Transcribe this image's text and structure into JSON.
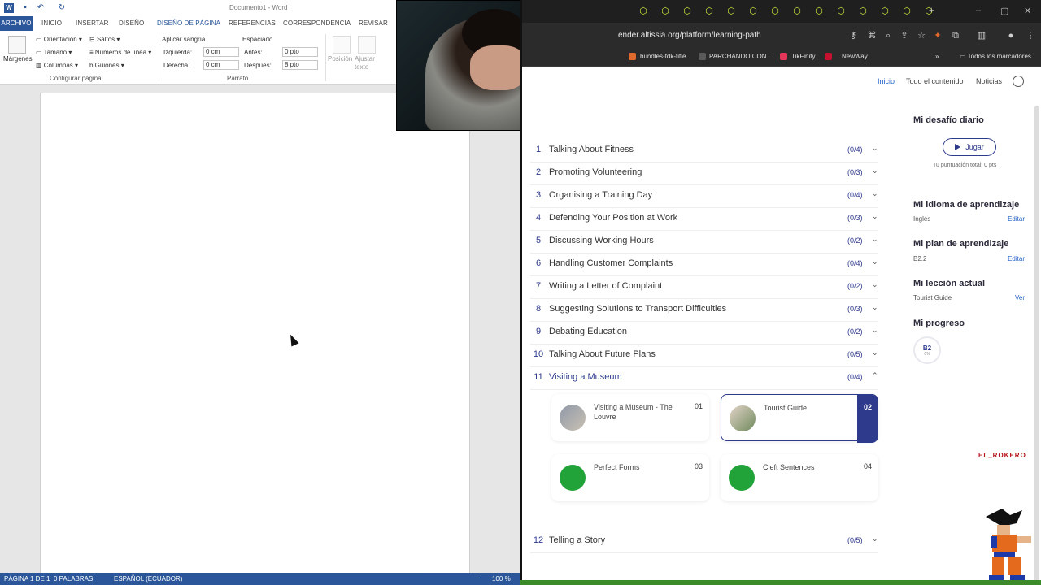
{
  "word": {
    "title": "Documento1 - Word",
    "tabs": [
      "ARCHIVO",
      "INICIO",
      "INSERTAR",
      "DISEÑO",
      "DISEÑO DE PÁGINA",
      "REFERENCIAS",
      "CORRESPONDENCIA",
      "REVISAR"
    ],
    "active_tab": "DISEÑO DE PÁGINA",
    "ribbon": {
      "margins": "Márgenes",
      "orientation": "Orientación",
      "size": "Tamaño",
      "columns": "Columnas",
      "breaks": "Saltos",
      "line_numbers": "Números de línea",
      "hyphenation": "Guiones",
      "group_page_setup": "Configurar página",
      "indent_label": "Aplicar sangría",
      "indent_left_label": "Izquierda:",
      "indent_left_value": "0 cm",
      "indent_right_label": "Derecha:",
      "indent_right_value": "0 cm",
      "spacing_label": "Espaciado",
      "spacing_before_label": "Antes:",
      "spacing_before_value": "0 pto",
      "spacing_after_label": "Después:",
      "spacing_after_value": "8 pto",
      "group_paragraph": "Párrafo",
      "position": "Posición",
      "wrap_text": "Ajustar texto"
    },
    "status": {
      "page": "PÁGINA 1 DE 1",
      "words": "0 PALABRAS",
      "language": "ESPAÑOL (ECUADOR)",
      "zoom": "100 %"
    }
  },
  "browser": {
    "url": "ender.altissia.org/platform/learning-path",
    "bookmarks": [
      "bundles-tdk-title",
      "PARCHANDO CON...",
      "TikFinity",
      "NewWay",
      "Todos los marcadores"
    ]
  },
  "site": {
    "nav": [
      "Inicio",
      "Todo el contenido",
      "Noticias"
    ],
    "lessons": [
      {
        "num": "1",
        "title": "Talking About Fitness",
        "count": "(0/4)"
      },
      {
        "num": "2",
        "title": "Promoting Volunteering",
        "count": "(0/3)"
      },
      {
        "num": "3",
        "title": "Organising a Training Day",
        "count": "(0/4)"
      },
      {
        "num": "4",
        "title": "Defending Your Position at Work",
        "count": "(0/3)"
      },
      {
        "num": "5",
        "title": "Discussing Working Hours",
        "count": "(0/2)"
      },
      {
        "num": "6",
        "title": "Handling Customer Complaints",
        "count": "(0/4)"
      },
      {
        "num": "7",
        "title": "Writing a Letter of Complaint",
        "count": "(0/2)"
      },
      {
        "num": "8",
        "title": "Suggesting Solutions to Transport Difficulties",
        "count": "(0/3)"
      },
      {
        "num": "9",
        "title": "Debating Education",
        "count": "(0/2)"
      },
      {
        "num": "10",
        "title": "Talking About Future Plans",
        "count": "(0/5)"
      },
      {
        "num": "11",
        "title": "Visiting a Museum",
        "count": "(0/4)"
      },
      {
        "num": "12",
        "title": "Telling a Story",
        "count": "(0/5)"
      }
    ],
    "activities": [
      {
        "title": "Visiting a Museum - The Louvre",
        "num": "01"
      },
      {
        "title": "Tourist Guide",
        "num": "02"
      },
      {
        "title": "Perfect Forms",
        "num": "03"
      },
      {
        "title": "Cleft Sentences",
        "num": "04"
      }
    ],
    "side": {
      "daily_title": "Mi desafío diario",
      "play": "Jugar",
      "score": "Tu puntuación total: 0 pts",
      "lang_title": "Mi idioma de aprendizaje",
      "lang_value": "Inglés",
      "edit": "Editar",
      "plan_title": "Mi plan de aprendizaje",
      "plan_value": "B2.2",
      "lesson_title": "Mi lección actual",
      "lesson_value": "Tourist Guide",
      "view": "Ver",
      "progress_title": "Mi progreso",
      "progress_level": "B2",
      "progress_pct": "0%"
    },
    "streamer_tag": "EL_ROKERO"
  },
  "colors": {
    "word_blue": "#2b579a",
    "accent": "#2e3a8c",
    "link": "#2563c9",
    "green": "#22a33a"
  }
}
